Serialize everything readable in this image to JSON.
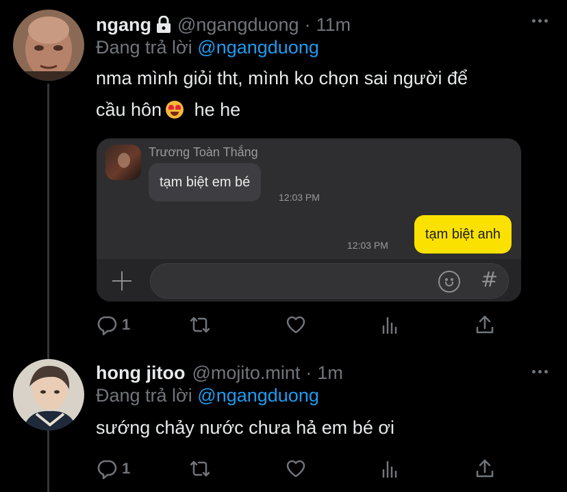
{
  "tweets": [
    {
      "display_name": "ngang",
      "handle": "@ngangduong",
      "time": "11m",
      "reply_label": "Đang trả lời",
      "reply_handle": "@ngangduong",
      "text_line1": "nma mình giỏi tht, mình ko chọn sai người để",
      "text_line2_a": "cầu hôn",
      "text_line2_b": " he he",
      "emoji": "heart-eyes-emoji",
      "reply_count": "1",
      "chat": {
        "sender": "Trương Toàn Thắng",
        "incoming_message": "tạm biệt em bé",
        "incoming_time": "12:03 PM",
        "outgoing_message": "tạm biệt anh",
        "outgoing_time": "12:03 PM",
        "colors": {
          "outgoing_bubble": "#fae100",
          "incoming_bubble": "#3e3e42"
        }
      }
    },
    {
      "display_name": "hong jitoo",
      "handle": "@mojito.mint",
      "time": "1m",
      "reply_label": "Đang trả lời",
      "reply_handle": "@ngangduong",
      "text": "sướng chảy nước chưa hả em bé ơi",
      "reply_count": "1"
    }
  ],
  "colors": {
    "accent": "#1d9bf0",
    "muted": "#71767b",
    "background": "#000000"
  },
  "icons": [
    "lock-icon",
    "more-icon",
    "reply-icon",
    "retweet-icon",
    "like-icon",
    "views-icon",
    "share-icon",
    "plus-icon",
    "smiley-icon",
    "hash-icon"
  ]
}
